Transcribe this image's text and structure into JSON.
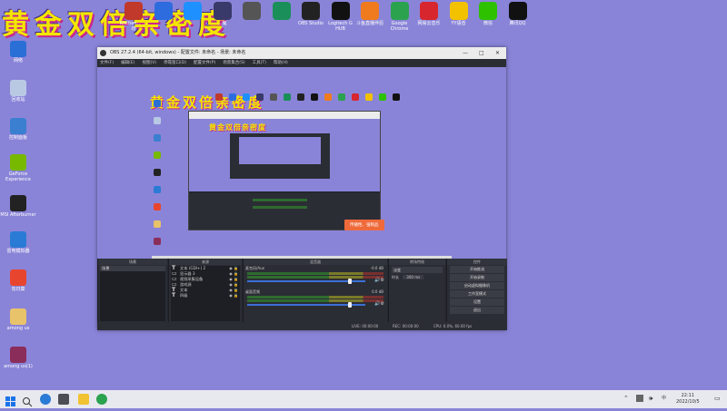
{
  "banner": "黄金双倍亲密度",
  "preview_banner": "黄金双倍亲密度",
  "inner_banner": "黄金双倍亲密度",
  "top_icons": [
    {
      "label": "Kitchen…\n…坊",
      "icon": "game-icon",
      "color": "#c0392b"
    },
    {
      "label": "",
      "icon": "app-icon",
      "color": "#2d6cdf"
    },
    {
      "label": "",
      "icon": "app-icon",
      "color": "#1e90ff"
    },
    {
      "label": "…鬼",
      "icon": "app-icon",
      "color": "#3a3a6a"
    },
    {
      "label": "",
      "icon": "app-icon",
      "color": "#555"
    },
    {
      "label": "",
      "icon": "app-icon",
      "color": "#1a8f5a"
    },
    {
      "label": "OBS Studio",
      "icon": "obs-icon",
      "color": "#222"
    },
    {
      "label": "Logitech G HUB",
      "icon": "logitech-icon",
      "color": "#111"
    },
    {
      "label": "斗鱼直播伴侣",
      "icon": "douyu-icon",
      "color": "#f07b1e"
    },
    {
      "label": "Google Chrome",
      "icon": "chrome-icon",
      "color": "#2aa24e"
    },
    {
      "label": "网易云音乐",
      "icon": "netease-music-icon",
      "color": "#d7262e"
    },
    {
      "label": "YY语音",
      "icon": "yy-icon",
      "color": "#f2c200"
    },
    {
      "label": "微信",
      "icon": "wechat-icon",
      "color": "#2dc100"
    },
    {
      "label": "腾讯QQ",
      "icon": "qq-icon",
      "color": "#111"
    }
  ],
  "left_icons": [
    {
      "label": "网络",
      "icon": "network-icon",
      "color": "#2a6fd6"
    },
    {
      "label": "回收站",
      "icon": "recycle-bin-icon",
      "color": "#b9c9e4"
    },
    {
      "label": "控制面板",
      "icon": "control-panel-icon",
      "color": "#3a7fd0"
    },
    {
      "label": "GeForce Experience",
      "icon": "geforce-icon",
      "color": "#76b900"
    },
    {
      "label": "MSI Afterburner",
      "icon": "msi-icon",
      "color": "#222"
    },
    {
      "label": "雷电模拟器",
      "icon": "emulator-icon",
      "color": "#2a7bd5"
    },
    {
      "label": "向日葵",
      "icon": "sunflower-icon",
      "color": "#e8452f"
    },
    {
      "label": "among us",
      "icon": "folder-icon",
      "color": "#e8c36a"
    },
    {
      "label": "among us(1)",
      "icon": "winrar-icon",
      "color": "#8b2d5a"
    }
  ],
  "obs": {
    "title": "OBS 27.2.4 (64-bit, windows) - 配置文件: 未命名 - 场景: 未命名",
    "menu": [
      "文件(F)",
      "编辑(E)",
      "视图(V)",
      "停靠窗口(D)",
      "配置文件(P)",
      "场景集合(S)",
      "工具(T)",
      "帮助(H)"
    ],
    "toast": "传播性、强制品",
    "scene_strip": {
      "label": "未选择源",
      "properties": "属性",
      "filters": "滤镜"
    },
    "docks": {
      "scenes": {
        "title": "场景",
        "items": [
          "场景"
        ]
      },
      "sources": {
        "title": "来源",
        "items": [
          {
            "name": "文本 (GDI+) 2",
            "type": "text"
          },
          {
            "name": "显示器 3",
            "type": "display"
          },
          {
            "name": "视频采集设备",
            "type": "video"
          },
          {
            "name": "游戏源",
            "type": "game"
          },
          {
            "name": "文本",
            "type": "text"
          },
          {
            "name": "四级",
            "type": "text"
          }
        ]
      },
      "mixer": {
        "title": "混音器",
        "channels": [
          {
            "name": "麦克风/Aux",
            "db": "-0.0 dB"
          },
          {
            "name": "桌面音频",
            "db": "0.0 dB"
          }
        ]
      },
      "transitions": {
        "title": "转场特效",
        "type": "淡变",
        "duration_label": "时长",
        "duration": "300 ms"
      },
      "controls": {
        "title": "控件",
        "buttons": [
          "开始推流",
          "开始录制",
          "启动虚拟摄像机",
          "工作室模式",
          "设置",
          "退出"
        ]
      }
    },
    "status": {
      "live_label": "LIVE:",
      "live_time": "00:00:00",
      "rec_label": "REC:",
      "rec_time": "00:00:00",
      "cpu": "CPU: 0.0%, 60.00 fps"
    }
  },
  "taskbar": {
    "clock_time": "22:11",
    "clock_date": "2022/10/5"
  }
}
